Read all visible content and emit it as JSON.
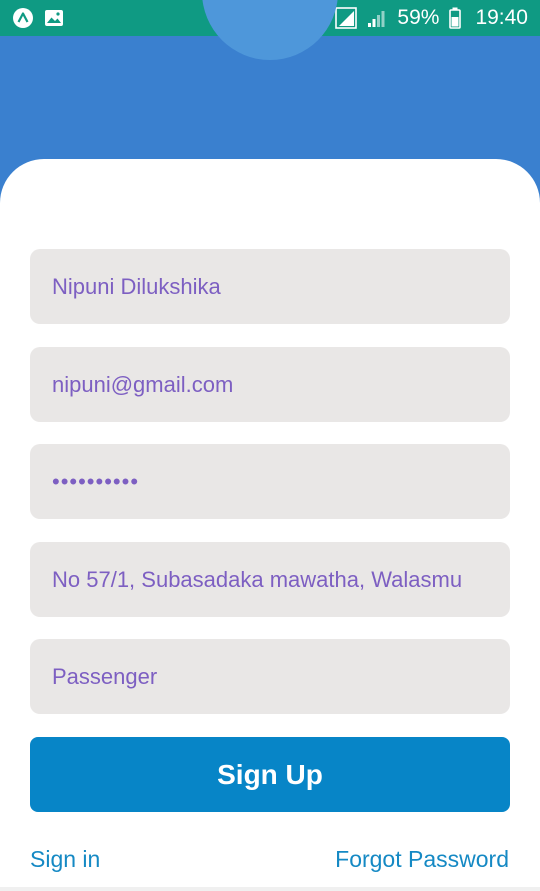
{
  "status_bar": {
    "battery_percent": "59%",
    "time": "19:40",
    "icons": [
      "app-a-icon",
      "image-icon",
      "alarm-icon",
      "wifi-icon",
      "sim-1-icon",
      "signal-icon",
      "signal-icon",
      "battery-icon"
    ]
  },
  "form": {
    "name_value": "Nipuni Dilukshika",
    "email_value": "nipuni@gmail.com",
    "password_value": "••••••••••",
    "address_value": "No 57/1, Subasadaka mawatha, Walasmu",
    "role_value": "Passenger"
  },
  "actions": {
    "signup_label": "Sign Up",
    "signin_label": "Sign in",
    "forgot_label": "Forgot Password"
  },
  "colors": {
    "status_bar": "#0f9a83",
    "header": "#3a80cf",
    "field_bg": "#e9e7e6",
    "field_text": "#7d5fc2",
    "button": "#0785c7",
    "link": "#1589c4"
  }
}
